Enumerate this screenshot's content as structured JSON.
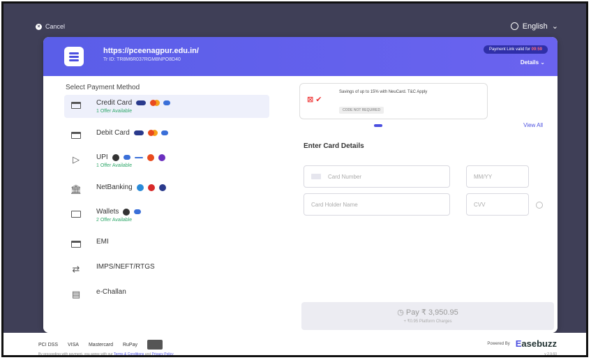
{
  "topbar": {
    "cancel": "Cancel",
    "language": "English"
  },
  "header": {
    "url": "https://pceenagpur.edu.in/",
    "txn": "Tr ID: TR8M6R037RGM8NPO8D40",
    "validity_label": "Payment Link valid for",
    "validity_time": "09:59",
    "details": "Details"
  },
  "left": {
    "title": "Select Payment Method",
    "items": [
      {
        "label": "Credit Card",
        "offer": "1 Offer Available"
      },
      {
        "label": "Debit Card",
        "offer": ""
      },
      {
        "label": "UPI",
        "offer": "1 Offer Available"
      },
      {
        "label": "NetBanking",
        "offer": ""
      },
      {
        "label": "Wallets",
        "offer": "2 Offer Available"
      },
      {
        "label": "EMI",
        "offer": ""
      },
      {
        "label": "IMPS/NEFT/RTGS",
        "offer": ""
      },
      {
        "label": "e-Challan",
        "offer": ""
      }
    ]
  },
  "right": {
    "offer_text": "Savings of up to 15% with NeuCard. T&C Apply",
    "offer_code": "CODE NOT REQUIRED",
    "view_all": "View All",
    "form_title": "Enter Card Details",
    "card_number_ph": "Card Number",
    "expiry_ph": "MM/YY",
    "holder_ph": "Card Holder Name",
    "cvv_ph": "CVV",
    "pay_label": "Pay ₹ 3,950.95",
    "pay_sub": "+ ₹0.95 Platform Charges"
  },
  "footer": {
    "logos": [
      "PCI DSS",
      "VISA",
      "Mastercard",
      "RuPay",
      "Card"
    ],
    "terms_prefix": "By proceeding with payment, you agree with our",
    "terms_link": "Terms & Conditions",
    "and": "and",
    "privacy_link": "Privacy Policy",
    "powered_by": "Powered By",
    "brand_prefix": "E",
    "brand": "asebuzz",
    "version": "v 2.9.60"
  }
}
